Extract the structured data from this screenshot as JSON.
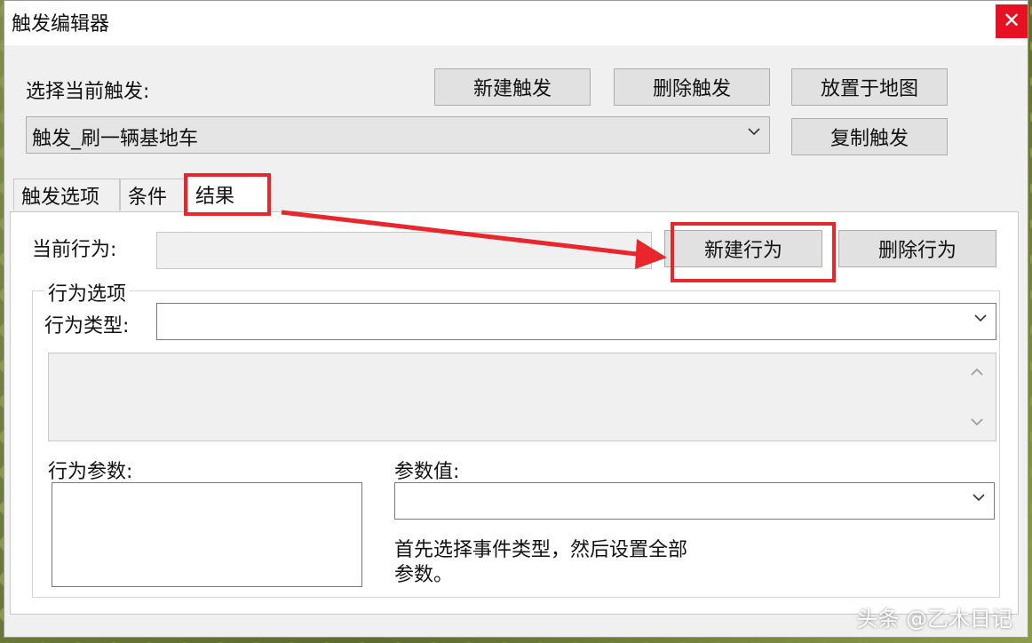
{
  "window": {
    "title": "触发编辑器",
    "close_glyph": "✕"
  },
  "trigger": {
    "select_label": "选择当前触发:",
    "selected": "触发_刷一辆基地车",
    "new_button": "新建触发",
    "delete_button": "删除触发",
    "place_button": "放置于地图",
    "copy_button": "复制触发"
  },
  "tabs": [
    {
      "label": "触发选项"
    },
    {
      "label": "条件"
    },
    {
      "label": "结果"
    }
  ],
  "action": {
    "current_label": "当前行为:",
    "current_value": "",
    "new_button": "新建行为",
    "delete_button": "删除行为",
    "options_group": "行为选项",
    "type_label": "行为类型:",
    "type_value": "",
    "params_label": "行为参数:",
    "param_value_label": "参数值:",
    "hint_line1": "首先选择事件类型，然后设置全部",
    "hint_line2": "参数。"
  },
  "watermark": "头条 @乙木日记",
  "colors": {
    "highlight": "#e8262b",
    "close_bg": "#e81123"
  }
}
